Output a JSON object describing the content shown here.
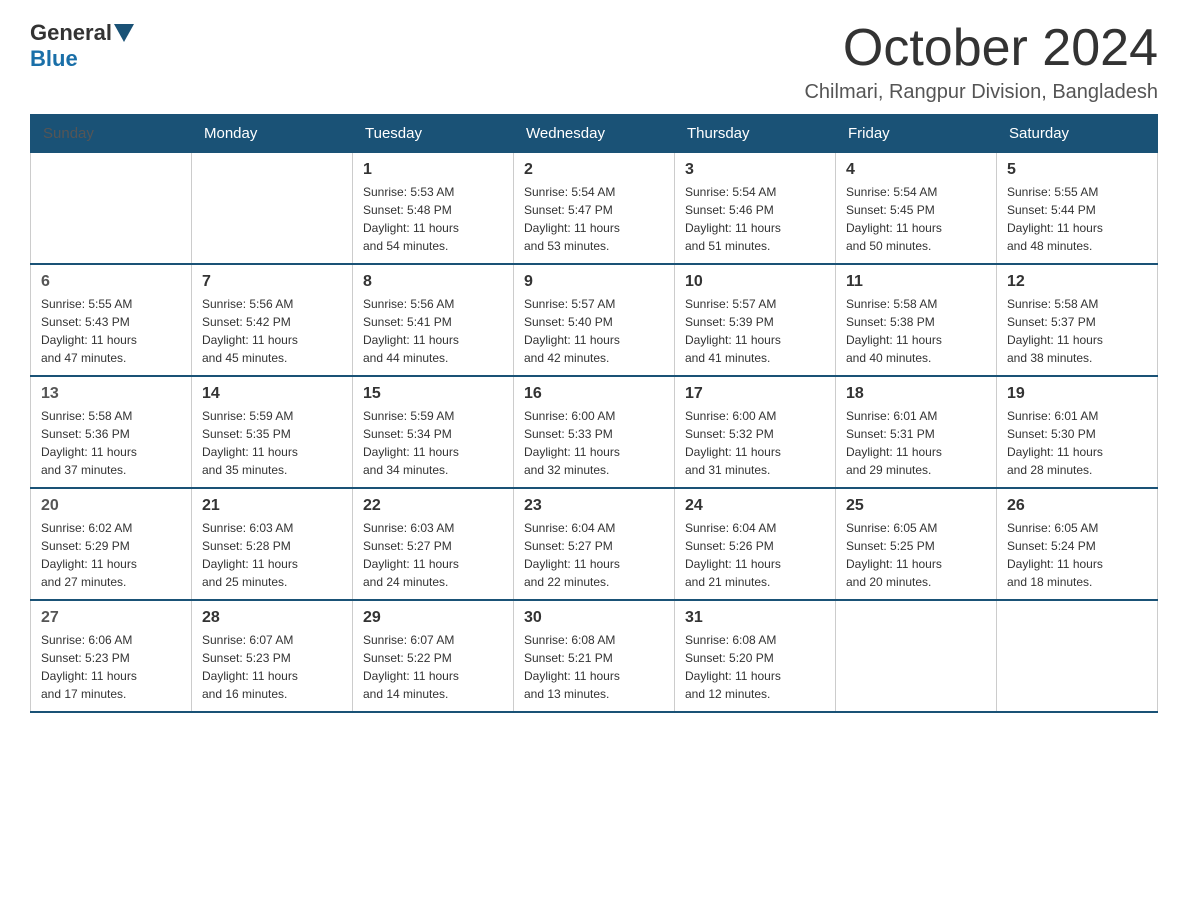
{
  "logo": {
    "general": "General",
    "blue": "Blue"
  },
  "title": {
    "month": "October 2024",
    "location": "Chilmari, Rangpur Division, Bangladesh"
  },
  "headers": [
    "Sunday",
    "Monday",
    "Tuesday",
    "Wednesday",
    "Thursday",
    "Friday",
    "Saturday"
  ],
  "weeks": [
    [
      {
        "day": "",
        "info": ""
      },
      {
        "day": "",
        "info": ""
      },
      {
        "day": "1",
        "info": "Sunrise: 5:53 AM\nSunset: 5:48 PM\nDaylight: 11 hours\nand 54 minutes."
      },
      {
        "day": "2",
        "info": "Sunrise: 5:54 AM\nSunset: 5:47 PM\nDaylight: 11 hours\nand 53 minutes."
      },
      {
        "day": "3",
        "info": "Sunrise: 5:54 AM\nSunset: 5:46 PM\nDaylight: 11 hours\nand 51 minutes."
      },
      {
        "day": "4",
        "info": "Sunrise: 5:54 AM\nSunset: 5:45 PM\nDaylight: 11 hours\nand 50 minutes."
      },
      {
        "day": "5",
        "info": "Sunrise: 5:55 AM\nSunset: 5:44 PM\nDaylight: 11 hours\nand 48 minutes."
      }
    ],
    [
      {
        "day": "6",
        "info": "Sunrise: 5:55 AM\nSunset: 5:43 PM\nDaylight: 11 hours\nand 47 minutes."
      },
      {
        "day": "7",
        "info": "Sunrise: 5:56 AM\nSunset: 5:42 PM\nDaylight: 11 hours\nand 45 minutes."
      },
      {
        "day": "8",
        "info": "Sunrise: 5:56 AM\nSunset: 5:41 PM\nDaylight: 11 hours\nand 44 minutes."
      },
      {
        "day": "9",
        "info": "Sunrise: 5:57 AM\nSunset: 5:40 PM\nDaylight: 11 hours\nand 42 minutes."
      },
      {
        "day": "10",
        "info": "Sunrise: 5:57 AM\nSunset: 5:39 PM\nDaylight: 11 hours\nand 41 minutes."
      },
      {
        "day": "11",
        "info": "Sunrise: 5:58 AM\nSunset: 5:38 PM\nDaylight: 11 hours\nand 40 minutes."
      },
      {
        "day": "12",
        "info": "Sunrise: 5:58 AM\nSunset: 5:37 PM\nDaylight: 11 hours\nand 38 minutes."
      }
    ],
    [
      {
        "day": "13",
        "info": "Sunrise: 5:58 AM\nSunset: 5:36 PM\nDaylight: 11 hours\nand 37 minutes."
      },
      {
        "day": "14",
        "info": "Sunrise: 5:59 AM\nSunset: 5:35 PM\nDaylight: 11 hours\nand 35 minutes."
      },
      {
        "day": "15",
        "info": "Sunrise: 5:59 AM\nSunset: 5:34 PM\nDaylight: 11 hours\nand 34 minutes."
      },
      {
        "day": "16",
        "info": "Sunrise: 6:00 AM\nSunset: 5:33 PM\nDaylight: 11 hours\nand 32 minutes."
      },
      {
        "day": "17",
        "info": "Sunrise: 6:00 AM\nSunset: 5:32 PM\nDaylight: 11 hours\nand 31 minutes."
      },
      {
        "day": "18",
        "info": "Sunrise: 6:01 AM\nSunset: 5:31 PM\nDaylight: 11 hours\nand 29 minutes."
      },
      {
        "day": "19",
        "info": "Sunrise: 6:01 AM\nSunset: 5:30 PM\nDaylight: 11 hours\nand 28 minutes."
      }
    ],
    [
      {
        "day": "20",
        "info": "Sunrise: 6:02 AM\nSunset: 5:29 PM\nDaylight: 11 hours\nand 27 minutes."
      },
      {
        "day": "21",
        "info": "Sunrise: 6:03 AM\nSunset: 5:28 PM\nDaylight: 11 hours\nand 25 minutes."
      },
      {
        "day": "22",
        "info": "Sunrise: 6:03 AM\nSunset: 5:27 PM\nDaylight: 11 hours\nand 24 minutes."
      },
      {
        "day": "23",
        "info": "Sunrise: 6:04 AM\nSunset: 5:27 PM\nDaylight: 11 hours\nand 22 minutes."
      },
      {
        "day": "24",
        "info": "Sunrise: 6:04 AM\nSunset: 5:26 PM\nDaylight: 11 hours\nand 21 minutes."
      },
      {
        "day": "25",
        "info": "Sunrise: 6:05 AM\nSunset: 5:25 PM\nDaylight: 11 hours\nand 20 minutes."
      },
      {
        "day": "26",
        "info": "Sunrise: 6:05 AM\nSunset: 5:24 PM\nDaylight: 11 hours\nand 18 minutes."
      }
    ],
    [
      {
        "day": "27",
        "info": "Sunrise: 6:06 AM\nSunset: 5:23 PM\nDaylight: 11 hours\nand 17 minutes."
      },
      {
        "day": "28",
        "info": "Sunrise: 6:07 AM\nSunset: 5:23 PM\nDaylight: 11 hours\nand 16 minutes."
      },
      {
        "day": "29",
        "info": "Sunrise: 6:07 AM\nSunset: 5:22 PM\nDaylight: 11 hours\nand 14 minutes."
      },
      {
        "day": "30",
        "info": "Sunrise: 6:08 AM\nSunset: 5:21 PM\nDaylight: 11 hours\nand 13 minutes."
      },
      {
        "day": "31",
        "info": "Sunrise: 6:08 AM\nSunset: 5:20 PM\nDaylight: 11 hours\nand 12 minutes."
      },
      {
        "day": "",
        "info": ""
      },
      {
        "day": "",
        "info": ""
      }
    ]
  ]
}
